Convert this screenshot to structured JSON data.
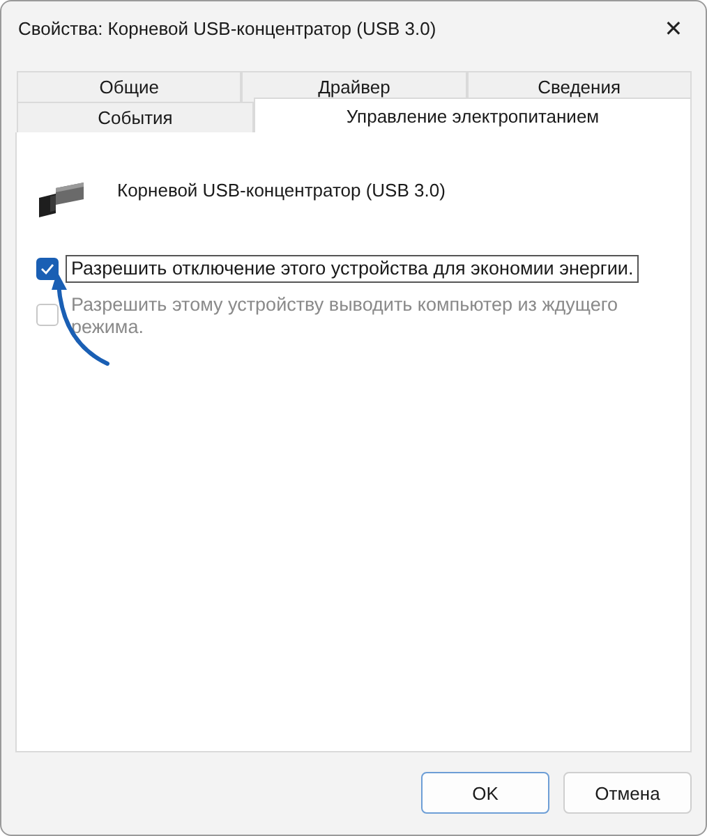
{
  "window": {
    "title": "Свойства: Корневой USB-концентратор (USB 3.0)",
    "close": "✕"
  },
  "tab_rows": [
    [
      {
        "label": "Общие",
        "selected": false
      },
      {
        "label": "Драйвер",
        "selected": false
      },
      {
        "label": "Сведения",
        "selected": false
      }
    ],
    [
      {
        "label": "События",
        "selected": false
      },
      {
        "label": "Управление электропитанием",
        "selected": true
      }
    ]
  ],
  "device": {
    "name": "Корневой USB-концентратор (USB 3.0)"
  },
  "options": [
    {
      "label": "Разрешить отключение этого устройства для экономии энергии.",
      "checked": true,
      "disabled": false,
      "focused": true
    },
    {
      "label": "Разрешить этому устройству выводить компьютер из ждущего режима.",
      "checked": false,
      "disabled": true,
      "focused": false
    }
  ],
  "buttons": [
    {
      "label": "OK",
      "default": true
    },
    {
      "label": "Отмена",
      "default": false
    }
  ]
}
